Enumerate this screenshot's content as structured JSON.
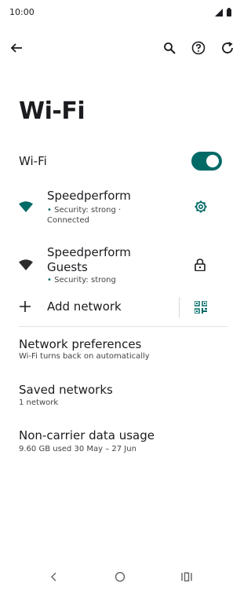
{
  "status_bar": {
    "time": "10:00"
  },
  "header": {
    "back_icon": "arrow-back-icon",
    "search_icon": "search-icon",
    "help_icon": "help-icon",
    "refresh_icon": "refresh-icon"
  },
  "page": {
    "title": "Wi-Fi"
  },
  "wifi_master": {
    "label": "Wi-Fi",
    "enabled": true,
    "accent": "#006a66"
  },
  "networks": [
    {
      "name": "Speedperform",
      "security_line1": "Security: strong ·",
      "security_line2": "Connected",
      "action_icon": "gear-icon"
    },
    {
      "name_line1": "Speedperform",
      "name_line2": "Guests",
      "security": "Security: strong",
      "action_icon": "lock-icon"
    }
  ],
  "add_network": {
    "label": "Add network",
    "qr_icon": "qr-code-icon"
  },
  "preferences": [
    {
      "title": "Network preferences",
      "subtitle": "Wi-Fi turns back on automatically"
    },
    {
      "title": "Saved networks",
      "subtitle": "1 network"
    },
    {
      "title": "Non-carrier data usage",
      "subtitle": "9.60 GB used 30 May – 27 Jun"
    }
  ]
}
